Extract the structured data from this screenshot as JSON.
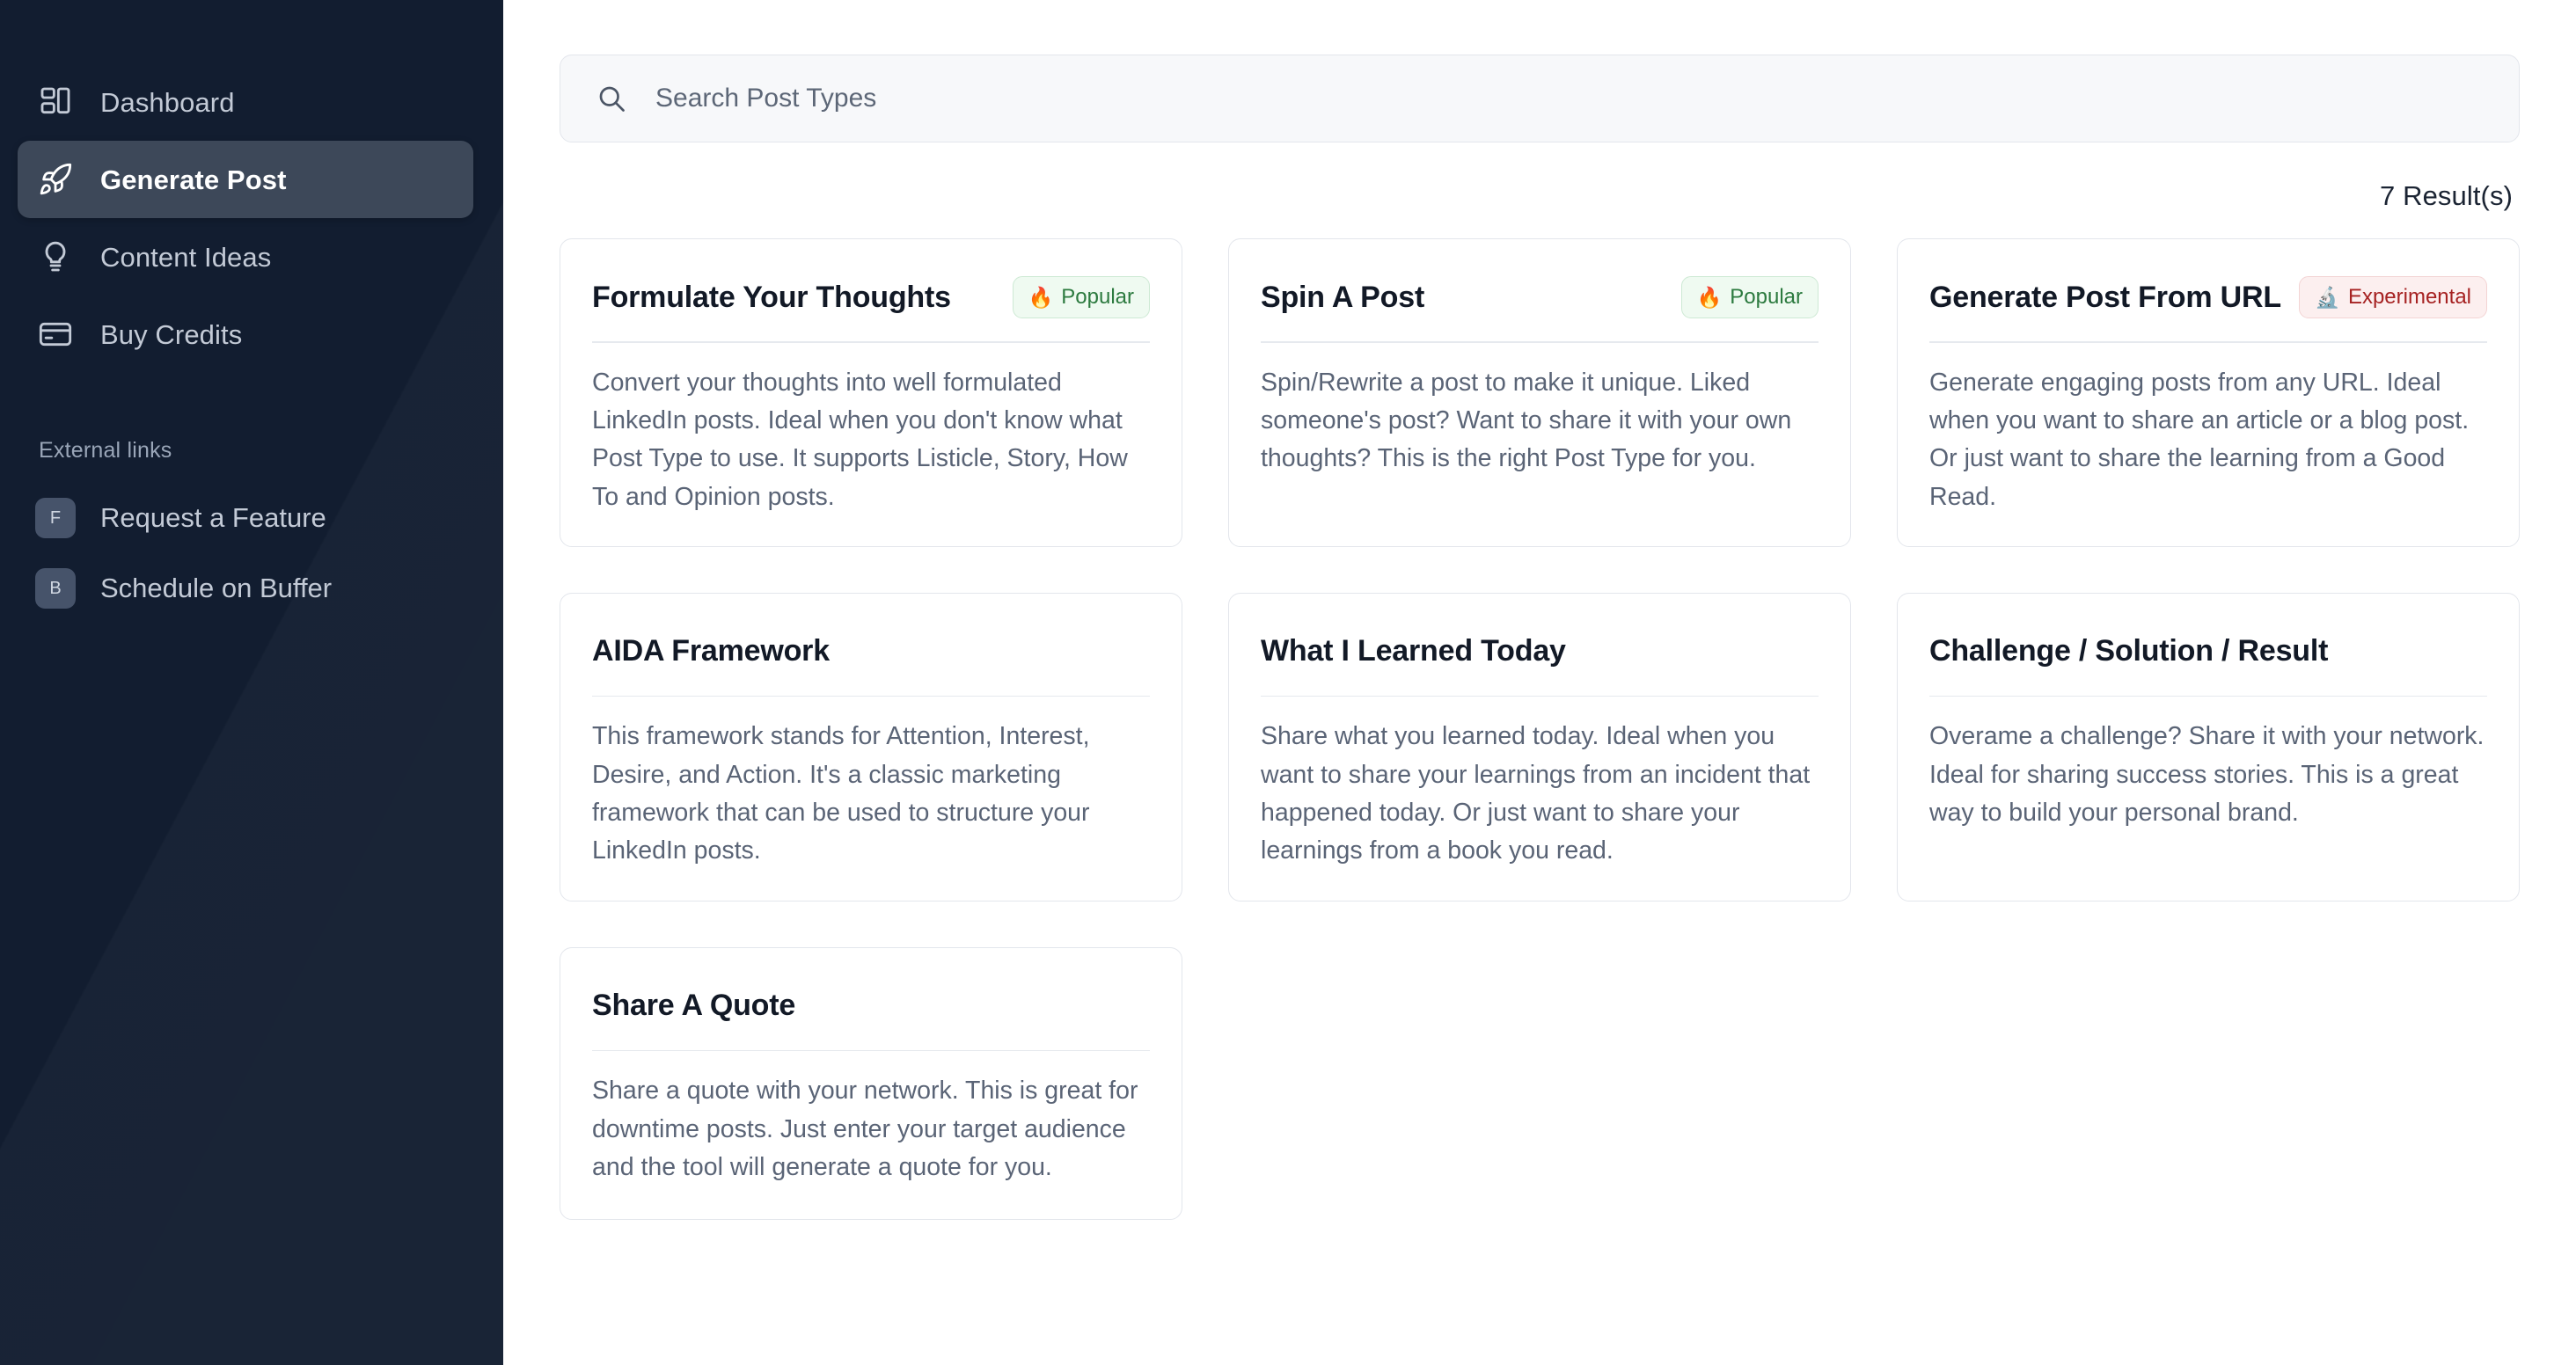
{
  "sidebar": {
    "nav_items": [
      {
        "label": "Dashboard",
        "icon": "layout-dashboard-icon",
        "active": false
      },
      {
        "label": "Generate Post",
        "icon": "rocket-icon",
        "active": true
      },
      {
        "label": "Content Ideas",
        "icon": "lightbulb-icon",
        "active": false
      },
      {
        "label": "Buy Credits",
        "icon": "credit-card-icon",
        "active": false
      }
    ],
    "external_heading": "External links",
    "external_items": [
      {
        "badge": "F",
        "label": "Request a Feature"
      },
      {
        "badge": "B",
        "label": "Schedule on Buffer"
      }
    ],
    "bg_color": "#121d30",
    "active_bg_color": "#3d4859"
  },
  "search": {
    "placeholder": "Search Post Types",
    "value": "",
    "icon": "search-icon"
  },
  "results": {
    "count_label": "7 Result(s)"
  },
  "badges": {
    "popular": {
      "label": "Popular",
      "emoji": "🔥",
      "bg": "#effaf1",
      "fg": "#2c7a3f"
    },
    "experimental": {
      "label": "Experimental",
      "emoji": "🔬",
      "bg": "#fcefef",
      "fg": "#a62222"
    }
  },
  "cards": [
    {
      "title": "Formulate Your Thoughts",
      "badge": "Popular",
      "badge_kind": "popular",
      "badge_emoji": "🔥",
      "description": "Convert your thoughts into well formulated LinkedIn posts. Ideal when you don't know what Post Type to use. It supports Listicle, Story, How To and Opinion posts."
    },
    {
      "title": "Spin A Post",
      "badge": "Popular",
      "badge_kind": "popular",
      "badge_emoji": "🔥",
      "description": "Spin/Rewrite a post to make it unique. Liked someone's post? Want to share it with your own thoughts? This is the right Post Type for you."
    },
    {
      "title": "Generate Post From URL",
      "badge": "Experimental",
      "badge_kind": "experimental",
      "badge_emoji": "🔬",
      "description": "Generate engaging posts from any URL. Ideal when you want to share an article or a blog post. Or just want to share the learning from a Good Read."
    },
    {
      "title": "AIDA Framework",
      "badge": "",
      "badge_kind": "",
      "badge_emoji": "",
      "description": "This framework stands for Attention, Interest, Desire, and Action. It's a classic marketing framework that can be used to structure your LinkedIn posts."
    },
    {
      "title": "What I Learned Today",
      "badge": "",
      "badge_kind": "",
      "badge_emoji": "",
      "description": "Share what you learned today. Ideal when you want to share your learnings from an incident that happened today. Or just want to share your learnings from a book you read."
    },
    {
      "title": "Challenge / Solution / Result",
      "badge": "",
      "badge_kind": "",
      "badge_emoji": "",
      "description": "Overame a challenge? Share it with your network. Ideal for sharing success stories. This is a great way to build your personal brand."
    },
    {
      "title": "Share A Quote",
      "badge": "",
      "badge_kind": "",
      "badge_emoji": "",
      "description": "Share a quote with your network. This is great for downtime posts. Just enter your target audience and the tool will generate a quote for you."
    }
  ]
}
